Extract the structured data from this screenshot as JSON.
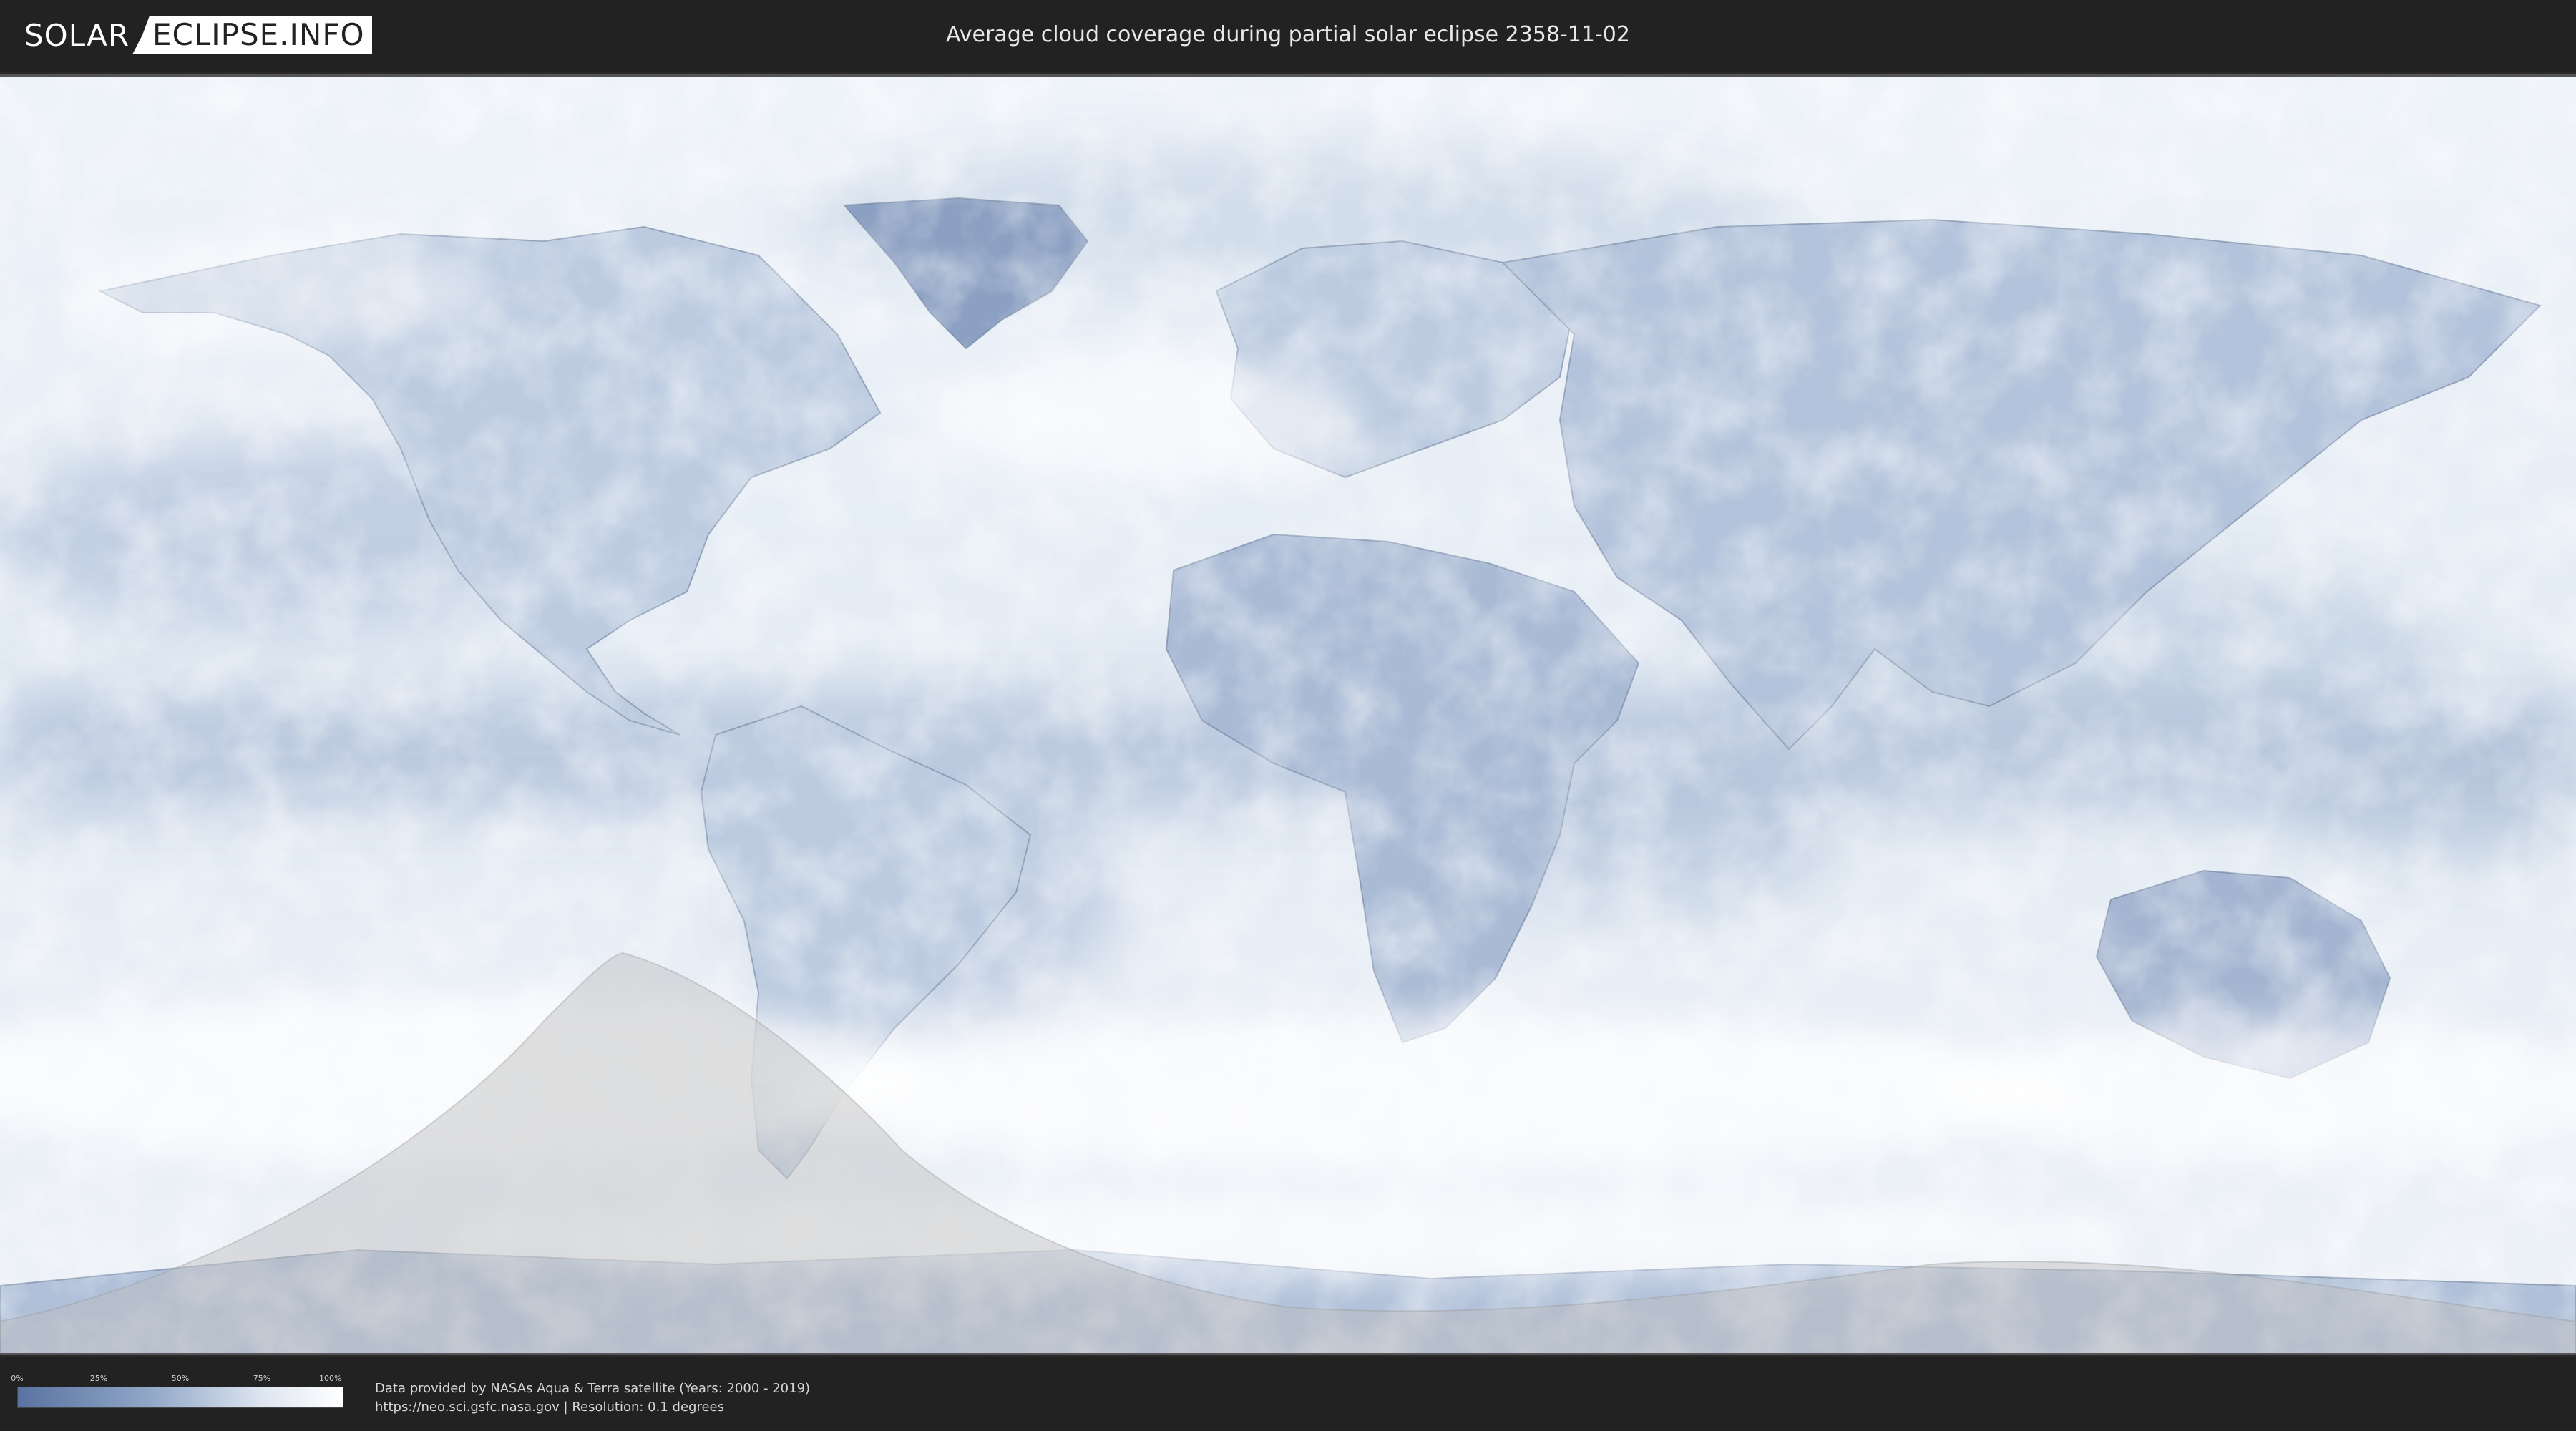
{
  "header": {
    "logo_left": "SOLAR",
    "logo_right": "ECLIPSE.INFO",
    "title": "Average cloud coverage during partial solar eclipse 2358-11-02"
  },
  "legend": {
    "ticks": [
      "0%",
      "25%",
      "50%",
      "75%",
      "100%"
    ],
    "gradient_colors": [
      "#5a72a0",
      "#8fa6c7",
      "#dde5ef",
      "#ffffff"
    ]
  },
  "footer": {
    "credit_line1": "Data provided by NASAs Aqua & Terra satellite (Years: 2000 - 2019)",
    "credit_line2": "https://neo.sci.gsfc.nasa.gov | Resolution: 0.1 degrees"
  },
  "map": {
    "projection": "equirectangular",
    "colors": {
      "clear_sky": "#5f7aa8",
      "cloudy": "#f4f7fb",
      "land_outline": "#6d7f99",
      "eclipse_overlay": "#bcbcbc"
    }
  }
}
